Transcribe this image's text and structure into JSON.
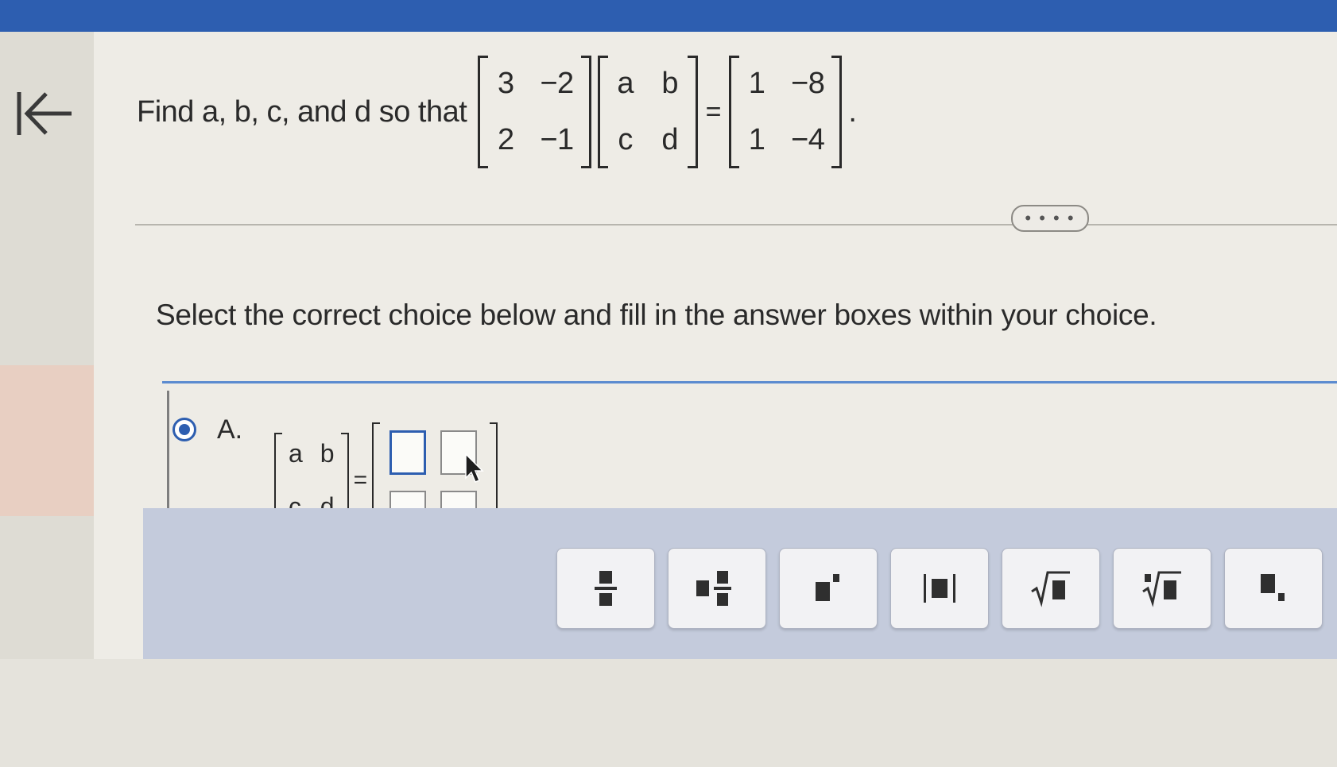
{
  "question": {
    "lead": "Find a, b, c, and d so that",
    "matrix1": [
      "3",
      "−2",
      "2",
      "−1"
    ],
    "matrix2": [
      "a",
      "b",
      "c",
      "d"
    ],
    "equals": "=",
    "matrix3": [
      "1",
      "−8",
      "1",
      "−4"
    ],
    "period": "."
  },
  "more_button": "• • • •",
  "instruction": "Select the correct choice below and fill in the answer boxes within your choice.",
  "choice_a": {
    "label": "A.",
    "matrix": [
      "a",
      "b",
      "c",
      "d"
    ],
    "equals": "=",
    "boxes": [
      "",
      "",
      "",
      ""
    ],
    "selected": true
  },
  "toolbar": {
    "buttons": [
      {
        "name": "fraction",
        "icon": "fraction-icon"
      },
      {
        "name": "mixed-number",
        "icon": "mixed-number-icon"
      },
      {
        "name": "exponent",
        "icon": "exponent-icon"
      },
      {
        "name": "absolute-value",
        "icon": "absolute-value-icon"
      },
      {
        "name": "square-root",
        "icon": "square-root-icon"
      },
      {
        "name": "nth-root",
        "icon": "nth-root-icon"
      },
      {
        "name": "subscript",
        "icon": "subscript-icon"
      }
    ]
  },
  "colors": {
    "accent": "#2d5eb0",
    "toolbar_bg": "#c4cbdc",
    "left_highlight": "#e8cfc2"
  }
}
